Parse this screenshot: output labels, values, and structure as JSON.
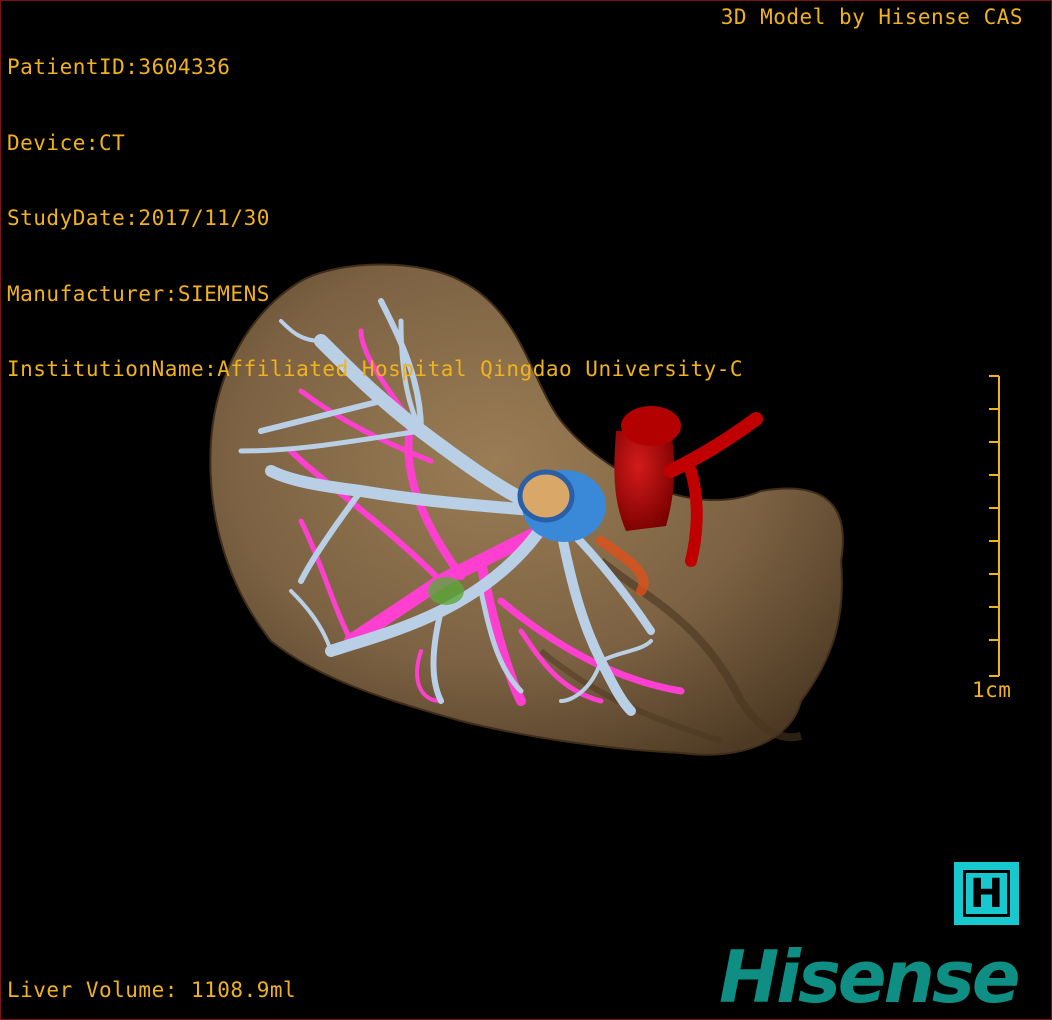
{
  "info": {
    "patient_id": "PatientID:3604336",
    "device": "Device:CT",
    "study_date": "StudyDate:2017/11/30",
    "manufacturer": "Manufacturer:SIEMENS",
    "institution": "InstitutionName:Affiliated Hospital Qingdao University-C"
  },
  "model_credit": "3D Model by Hisense CAS",
  "liver_volume": "Liver Volume: 1108.9ml",
  "scale": {
    "label": "1cm"
  },
  "logo": {
    "h_letter": "H",
    "wordmark": "Hisense"
  },
  "colors": {
    "overlay_text": "#f2b21c",
    "liver": "#7e6545",
    "portal_vein": "#ff3fcf",
    "hepatic_vein": "#b9cfe6",
    "artery_ivc": "#b00000",
    "logo_cyan": "#17c9cf",
    "wordmark_teal": "#0f8f84"
  }
}
